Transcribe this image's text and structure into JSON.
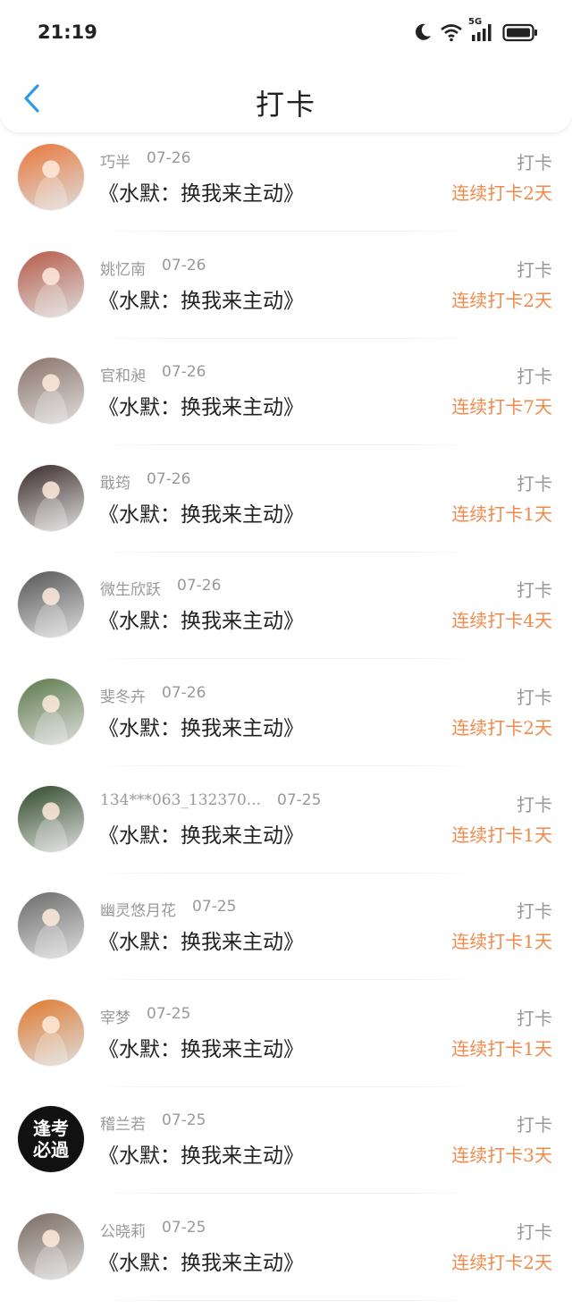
{
  "status_bar": {
    "time": "21:19",
    "network": "5G"
  },
  "nav": {
    "title": "打卡"
  },
  "colors": {
    "accent": "#2f9be6",
    "streak": "#f08a4b",
    "muted": "#999999"
  },
  "items": [
    {
      "name": "巧半",
      "date": "07-26",
      "book": "《水默：换我来主动》",
      "action": "打卡",
      "streak": "连续打卡2天",
      "avatar_color": "#e9773a"
    },
    {
      "name": "姚忆南",
      "date": "07-26",
      "book": "《水默：换我来主动》",
      "action": "打卡",
      "streak": "连续打卡2天",
      "avatar_color": "#b65a48"
    },
    {
      "name": "官和昶",
      "date": "07-26",
      "book": "《水默：换我来主动》",
      "action": "打卡",
      "streak": "连续打卡7天",
      "avatar_color": "#8a7268"
    },
    {
      "name": "戢筠",
      "date": "07-26",
      "book": "《水默：换我来主动》",
      "action": "打卡",
      "streak": "连续打卡1天",
      "avatar_color": "#3a2a2a"
    },
    {
      "name": "微生欣跃",
      "date": "07-26",
      "book": "《水默：换我来主动》",
      "action": "打卡",
      "streak": "连续打卡4天",
      "avatar_color": "#555555"
    },
    {
      "name": "斐冬卉",
      "date": "07-26",
      "book": "《水默：换我来主动》",
      "action": "打卡",
      "streak": "连续打卡2天",
      "avatar_color": "#5d7a4a"
    },
    {
      "name": "134***063_132370...",
      "date": "07-25",
      "book": "《水默：换我来主动》",
      "action": "打卡",
      "streak": "连续打卡1天",
      "avatar_color": "#2f4a2a"
    },
    {
      "name": "幽灵悠月花",
      "date": "07-25",
      "book": "《水默：换我来主动》",
      "action": "打卡",
      "streak": "连续打卡1天",
      "avatar_color": "#6b6b6b"
    },
    {
      "name": "宰梦",
      "date": "07-25",
      "book": "《水默：换我来主动》",
      "action": "打卡",
      "streak": "连续打卡1天",
      "avatar_color": "#e07a2f"
    },
    {
      "name": "稽兰若",
      "date": "07-25",
      "book": "《水默：换我来主动》",
      "action": "打卡",
      "streak": "连续打卡3天",
      "avatar_color": "#111111",
      "avatar_text": "逢考必過"
    },
    {
      "name": "公晓莉",
      "date": "07-25",
      "book": "《水默：换我来主动》",
      "action": "打卡",
      "streak": "连续打卡2天",
      "avatar_color": "#7a6a60"
    }
  ]
}
